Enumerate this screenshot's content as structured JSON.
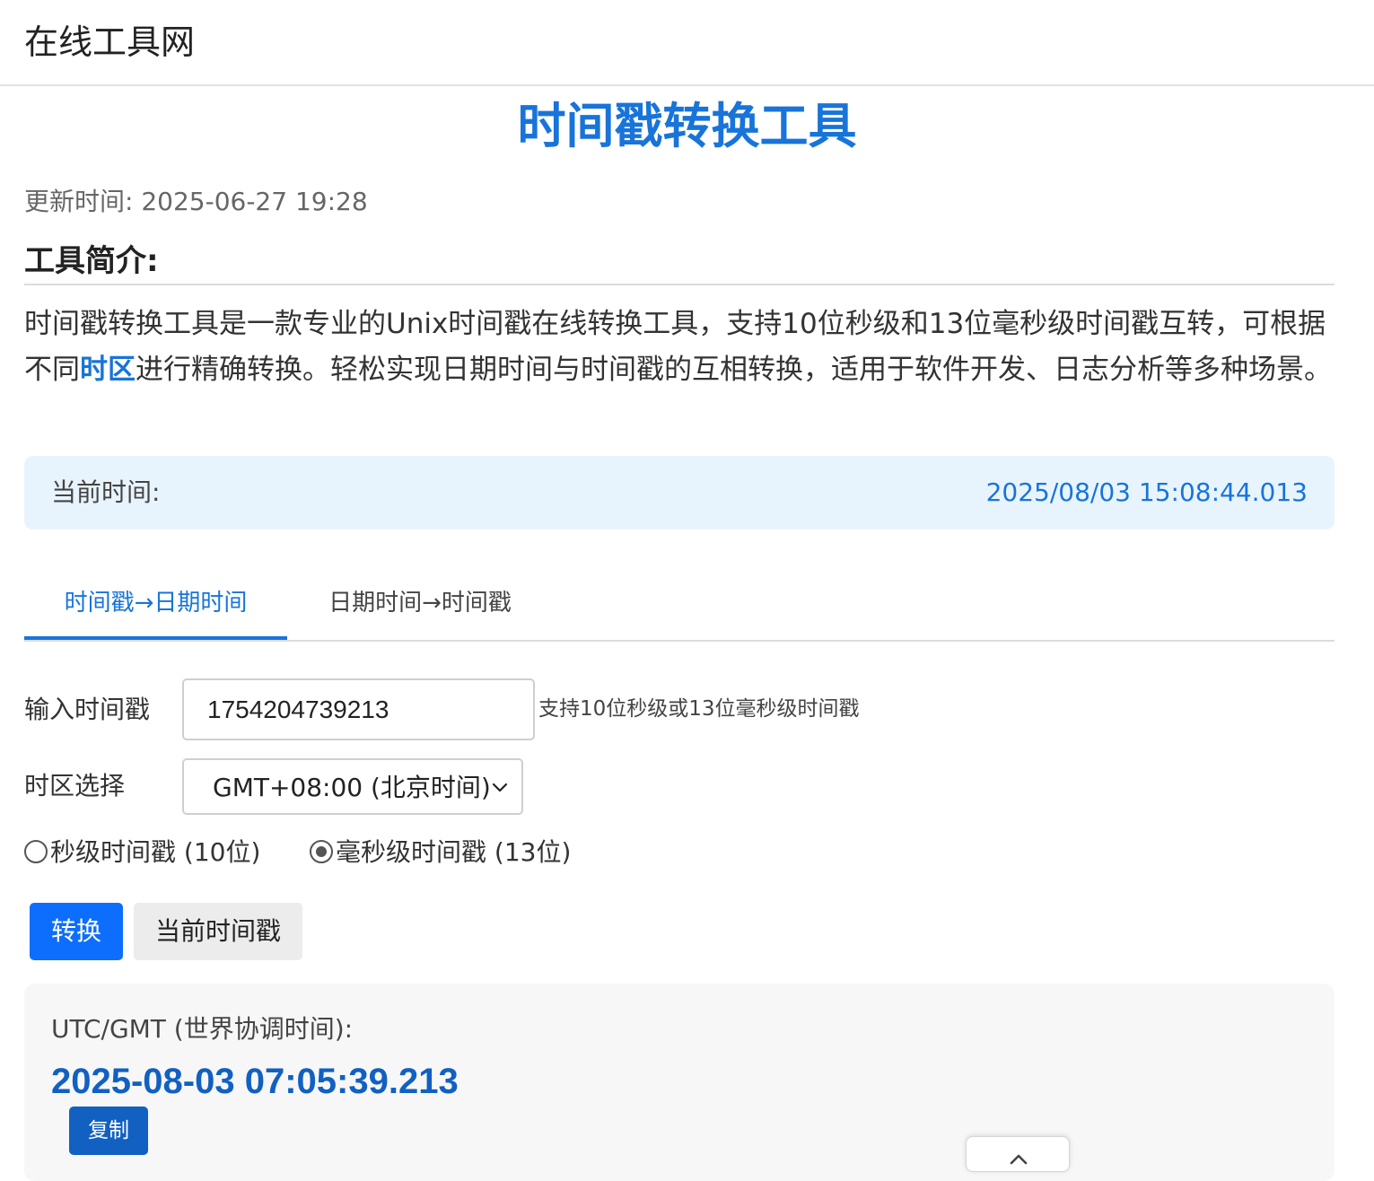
{
  "header": {
    "site_title": "在线工具网"
  },
  "page": {
    "title": "时间戳转换工具",
    "update_time": "更新时间: 2025-06-27 19:28"
  },
  "intro": {
    "heading": "工具简介:",
    "text_before": "时间戳转换工具是一款专业的Unix时间戳在线转换工具，支持10位秒级和13位毫秒级时间戳互转，可根据不同",
    "highlight": "时区",
    "text_after": "进行精确转换。轻松实现日期时间与时间戳的互相转换，适用于软件开发、日志分析等多种场景。"
  },
  "current_time": {
    "label": "当前时间:",
    "value": "2025/08/03 15:08:44.013"
  },
  "tabs": [
    {
      "label": "时间戳→日期时间",
      "active": true
    },
    {
      "label": "日期时间→时间戳",
      "active": false
    }
  ],
  "form": {
    "input_label": "输入时间戳",
    "input_value": "1754204739213",
    "input_hint": "支持10位秒级或13位毫秒级时间戳",
    "tz_label": "时区选择",
    "tz_selected": "GMT+08:00 (北京时间)",
    "radio_seconds": "秒级时间戳 (10位)",
    "radio_millis": "毫秒级时间戳 (13位)",
    "selected_precision": "millis"
  },
  "buttons": {
    "convert": "转换",
    "current_timestamp": "当前时间戳"
  },
  "result": {
    "label": "UTC/GMT (世界协调时间):",
    "value": "2025-08-03 07:05:39.213",
    "copy": "复制"
  },
  "icons": {
    "select_arrow": "chevron-down-icon",
    "back_to_top": "chevron-up-icon"
  },
  "colors": {
    "accent": "#1874d9",
    "primary_button": "#0d6efd",
    "result_value": "#1160c2",
    "current_box_bg": "#e8f4fd"
  }
}
